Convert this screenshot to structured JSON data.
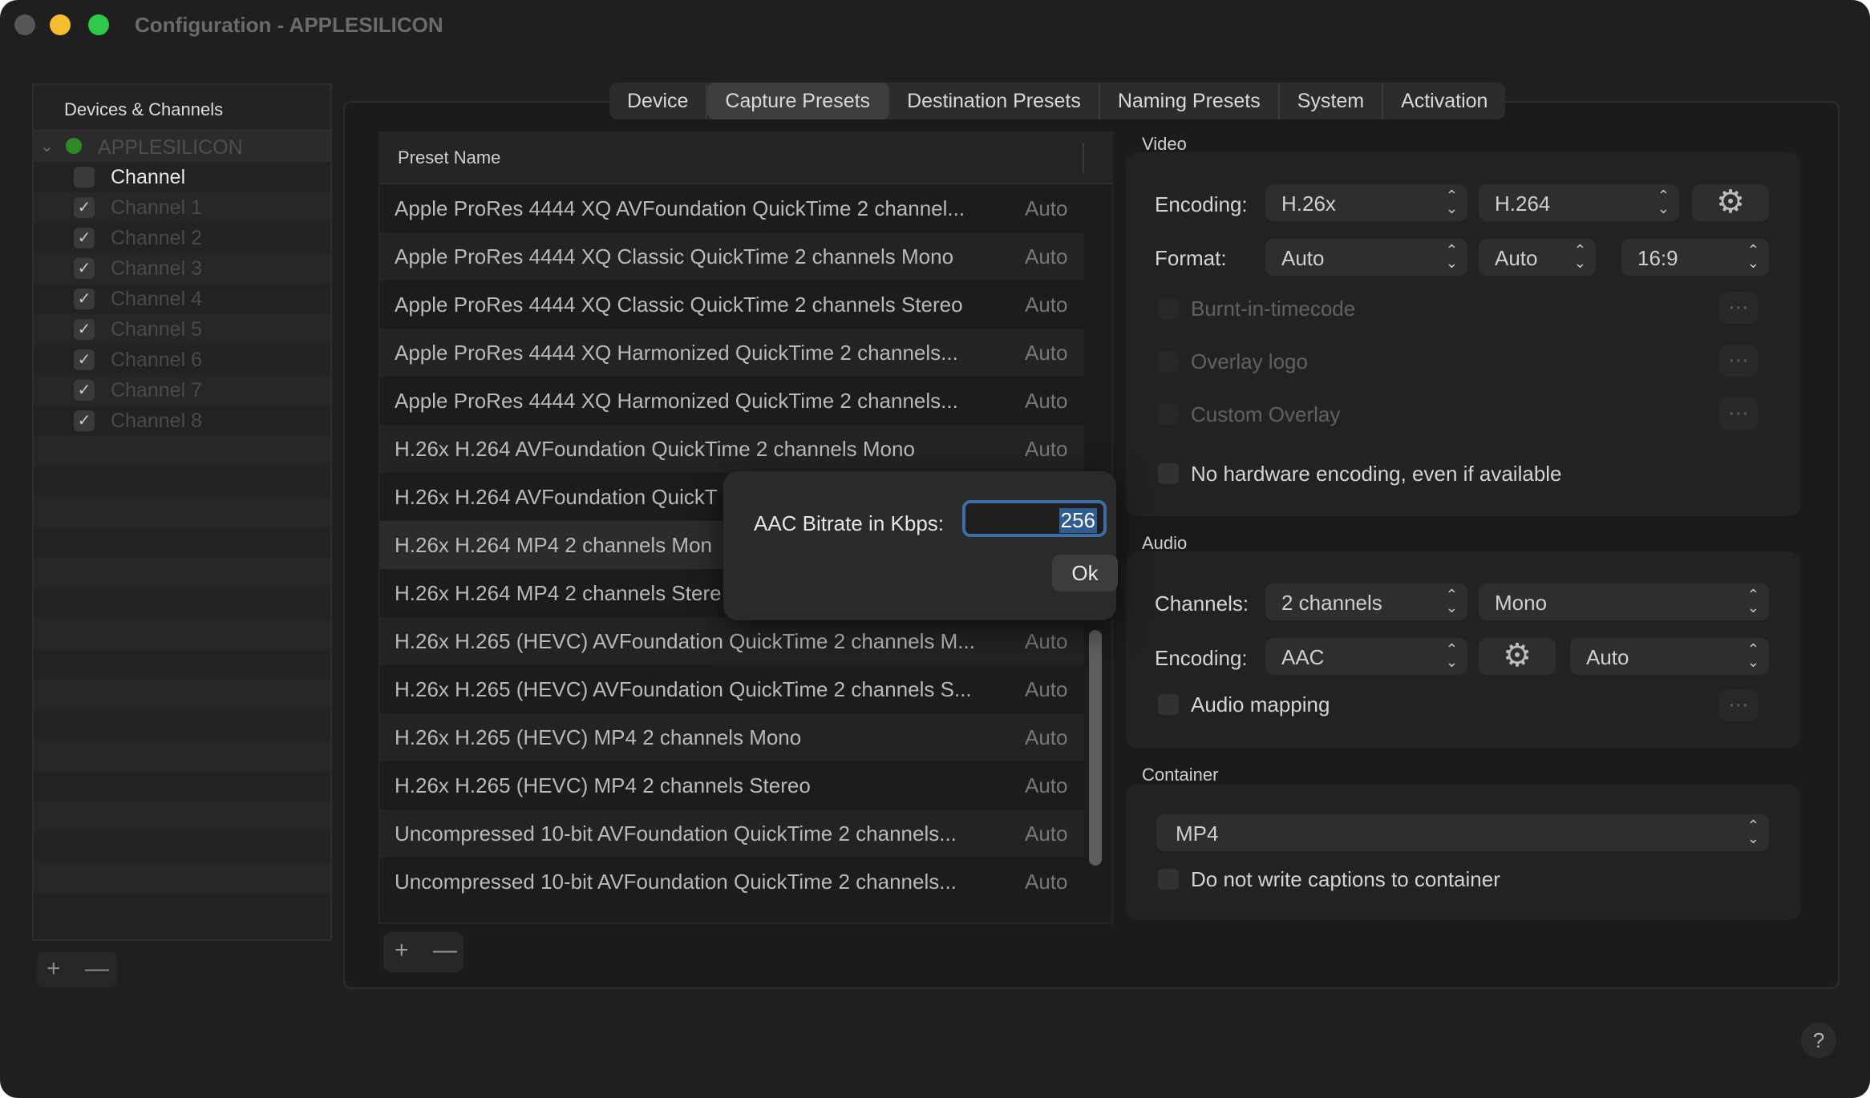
{
  "window": {
    "title": "Configuration - APPLESILICON"
  },
  "sidebar": {
    "header": "Devices & Channels",
    "device": "APPLESILICON",
    "channel_header": "Channel",
    "channels": [
      "Channel 1",
      "Channel 2",
      "Channel 3",
      "Channel 4",
      "Channel 5",
      "Channel 6",
      "Channel 7",
      "Channel 8"
    ],
    "add": "+",
    "remove": "—"
  },
  "tabs": [
    "Device",
    "Capture Presets",
    "Destination Presets",
    "Naming Presets",
    "System",
    "Activation"
  ],
  "presets": {
    "column_header": "Preset Name",
    "rows": [
      {
        "name": "Apple ProRes 4444 XQ AVFoundation QuickTime 2 channel...",
        "value": "Auto"
      },
      {
        "name": "Apple ProRes 4444 XQ Classic QuickTime 2 channels Mono",
        "value": "Auto"
      },
      {
        "name": "Apple ProRes 4444 XQ Classic QuickTime 2 channels Stereo",
        "value": "Auto"
      },
      {
        "name": "Apple ProRes 4444 XQ Harmonized QuickTime 2 channels...",
        "value": "Auto"
      },
      {
        "name": "Apple ProRes 4444 XQ Harmonized QuickTime 2 channels...",
        "value": "Auto"
      },
      {
        "name": "H.26x H.264 AVFoundation QuickTime 2 channels Mono",
        "value": "Auto"
      },
      {
        "name": "H.26x H.264 AVFoundation QuickT",
        "value": ""
      },
      {
        "name": "H.26x H.264 MP4 2 channels Mon",
        "value": ""
      },
      {
        "name": "H.26x H.264 MP4 2 channels Stere",
        "value": ""
      },
      {
        "name": "H.26x H.265 (HEVC) AVFoundation QuickTime 2 channels M...",
        "value": "Auto"
      },
      {
        "name": "H.26x H.265 (HEVC) AVFoundation QuickTime 2 channels S...",
        "value": "Auto"
      },
      {
        "name": "H.26x H.265 (HEVC) MP4 2 channels Mono",
        "value": "Auto"
      },
      {
        "name": "H.26x H.265 (HEVC) MP4 2 channels Stereo",
        "value": "Auto"
      },
      {
        "name": "Uncompressed 10-bit AVFoundation QuickTime 2 channels...",
        "value": "Auto"
      },
      {
        "name": "Uncompressed 10-bit AVFoundation QuickTime 2 channels...",
        "value": "Auto"
      }
    ],
    "add": "+",
    "remove": "—"
  },
  "video": {
    "title": "Video",
    "encoding_label": "Encoding:",
    "encoding": "H.26x",
    "codec": "H.264",
    "format_label": "Format:",
    "format1": "Auto",
    "format2": "Auto",
    "aspect": "16:9",
    "burnt_in": "Burnt-in-timecode",
    "overlay_logo": "Overlay logo",
    "custom_overlay": "Custom Overlay",
    "no_hw": "No hardware encoding, even if available"
  },
  "audio": {
    "title": "Audio",
    "channels_label": "Channels:",
    "channels": "2 channels",
    "mode": "Mono",
    "encoding_label": "Encoding:",
    "encoding": "AAC",
    "bitrate": "Auto",
    "mapping": "Audio mapping"
  },
  "container": {
    "title": "Container",
    "value": "MP4",
    "no_captions": "Do not write captions to container"
  },
  "dialog": {
    "label": "AAC Bitrate in Kbps:",
    "value": "256",
    "ok": "Ok"
  },
  "help": "?",
  "icons": {
    "gear": "gear-icon",
    "checkmark": "checkmark-icon",
    "ellipsis": "ellipsis-icon"
  }
}
